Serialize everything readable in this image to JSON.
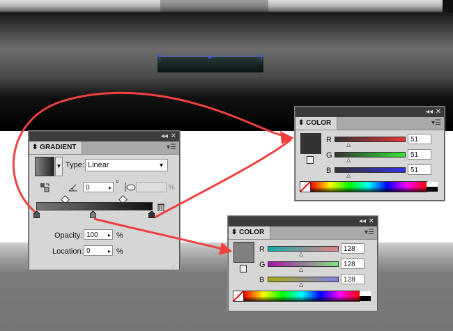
{
  "gradient_panel": {
    "title": "GRADIENT",
    "type_label": "Type:",
    "type_value": "Linear",
    "angle_value": "0",
    "angle_unit": "°",
    "aspect_unit": "%",
    "opacity_label": "Opacity:",
    "opacity_value": "100",
    "opacity_unit": "%",
    "location_label": "Location:",
    "location_value": "0",
    "location_unit": "%",
    "ramp_start_color": "#333333",
    "ramp_end_color": "#333333"
  },
  "color_panel_top": {
    "title": "COLOR",
    "r_label": "R",
    "g_label": "G",
    "b_label": "B",
    "r_value": "51",
    "g_value": "51",
    "b_value": "51",
    "swatch_color": "#333333"
  },
  "color_panel_bottom": {
    "title": "COLOR",
    "r_label": "R",
    "g_label": "G",
    "b_label": "B",
    "r_value": "128",
    "g_value": "128",
    "b_value": "128",
    "swatch_color": "#808080"
  },
  "colors": {
    "arrow": "#ef4040",
    "selection": "#3d5bd9"
  },
  "icons": [
    "panel-collapse-icon",
    "close-icon",
    "panel-menu-icon",
    "reverse-gradient-icon",
    "angle-icon",
    "aspect-ratio-icon",
    "delete-stop-icon",
    "lock-icon",
    "none-color-icon",
    "dropdown-arrow-icon"
  ]
}
